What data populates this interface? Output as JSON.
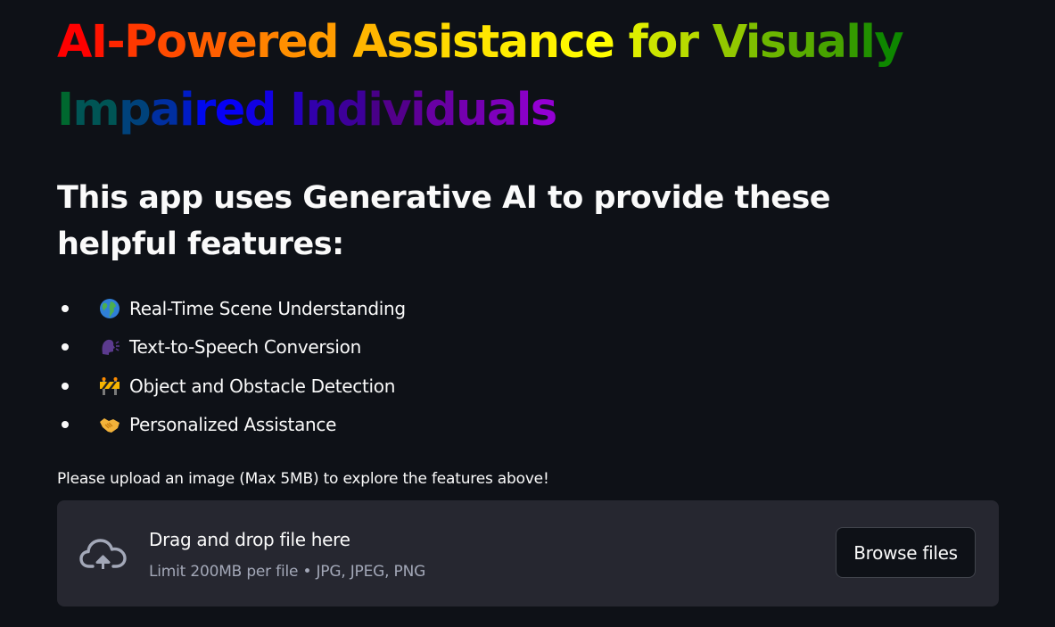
{
  "colors": {
    "background": "#0e1117",
    "text": "#fafafa",
    "dropzone_background": "#262730",
    "muted_text": "#a3a8b8",
    "button_border": "#41444c"
  },
  "title": {
    "text": "AI-Powered Assistance for Visually Impaired Individuals",
    "gradient": [
      "#ff0000",
      "#ff7f00",
      "#ffd700",
      "#ffff00",
      "#7fbf00",
      "#008000",
      "#0000ff",
      "#4b0082",
      "#9400d3"
    ]
  },
  "subtitle": "This app uses Generative AI to provide these helpful features:",
  "features": [
    {
      "icon": "globe-icon",
      "label": "Real-Time Scene Understanding"
    },
    {
      "icon": "speaking-head-icon",
      "label": "Text-to-Speech Conversion"
    },
    {
      "icon": "construction-barrier-icon",
      "label": "Object and Obstacle Detection"
    },
    {
      "icon": "handshake-icon",
      "label": "Personalized Assistance"
    }
  ],
  "uploader": {
    "label": "Please upload an image (Max 5MB) to explore the features above!",
    "dropzone_title": "Drag and drop file here",
    "dropzone_limit": "Limit 200MB per file • JPG, JPEG, PNG",
    "browse_button": "Browse files",
    "icon": "cloud-upload-icon"
  }
}
